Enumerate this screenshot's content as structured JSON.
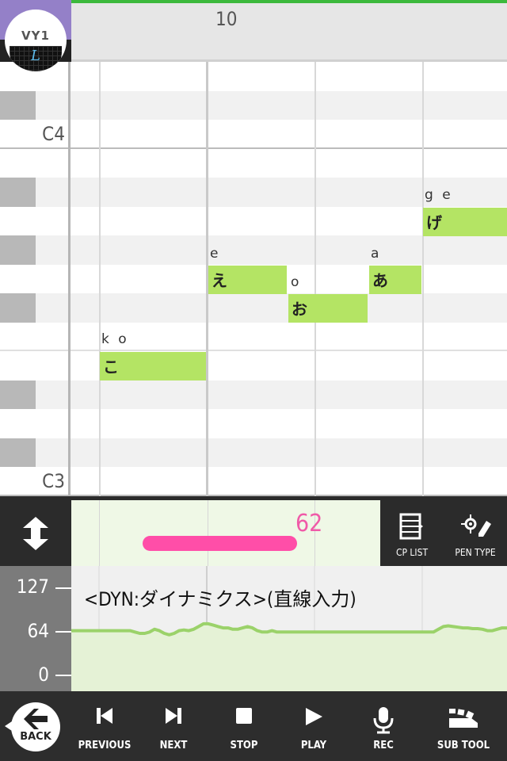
{
  "app": {
    "logo_text": "VY1",
    "logo_sub": "L"
  },
  "ruler": {
    "measure_number": "10",
    "playback_progress_color": "#3cb93c"
  },
  "piano_roll": {
    "octave_labels": [
      {
        "name": "C4"
      },
      {
        "name": "C3"
      }
    ],
    "notes": [
      {
        "lyric": "こ",
        "phoneme": "k o",
        "pitch": "E3"
      },
      {
        "lyric": "え",
        "phoneme": "e",
        "pitch": "G3"
      },
      {
        "lyric": "お",
        "phoneme": "o",
        "pitch": "F#3"
      },
      {
        "lyric": "あ",
        "phoneme": "a",
        "pitch": "G3"
      },
      {
        "lyric": "げ",
        "phoneme": "g e",
        "pitch": "A3"
      }
    ],
    "note_color": "#b4e464"
  },
  "control_bar": {
    "value": "62",
    "value_color": "#f05aa8",
    "cp_list_label": "CP LIST",
    "pen_type_label": "PEN TYPE"
  },
  "dynamics": {
    "title": "<DYN:ダイナミクス>(直線入力)",
    "ticks": [
      "127",
      "64",
      "0"
    ],
    "line_color": "#9bd26a",
    "curve": [
      64,
      64,
      64,
      64,
      64,
      64,
      64,
      64,
      64,
      64,
      64,
      64,
      64,
      62,
      60,
      60,
      62,
      66,
      64,
      60,
      58,
      60,
      64,
      65,
      64,
      66,
      70,
      74,
      74,
      72,
      70,
      68,
      68,
      66,
      66,
      68,
      70,
      68,
      64,
      62,
      62,
      64,
      62,
      62,
      62,
      62,
      62,
      62,
      62,
      62,
      62,
      62,
      62,
      62,
      62,
      62,
      62,
      62,
      62,
      62,
      62,
      62,
      62,
      62,
      62,
      62,
      62,
      62,
      62,
      62,
      62,
      62,
      62,
      62,
      62,
      66,
      70,
      71,
      70,
      69,
      68,
      68,
      67,
      67,
      66,
      64,
      64,
      66,
      68,
      68
    ]
  },
  "toolbar": {
    "back_label": "BACK",
    "buttons": [
      {
        "label": "PREVIOUS",
        "icon": "skip-previous-icon"
      },
      {
        "label": "NEXT",
        "icon": "skip-next-icon"
      },
      {
        "label": "STOP",
        "icon": "stop-icon"
      },
      {
        "label": "PLAY",
        "icon": "play-icon"
      },
      {
        "label": "REC",
        "icon": "microphone-icon"
      },
      {
        "label": "SUB TOOL",
        "icon": "sub-tool-icon"
      }
    ]
  }
}
